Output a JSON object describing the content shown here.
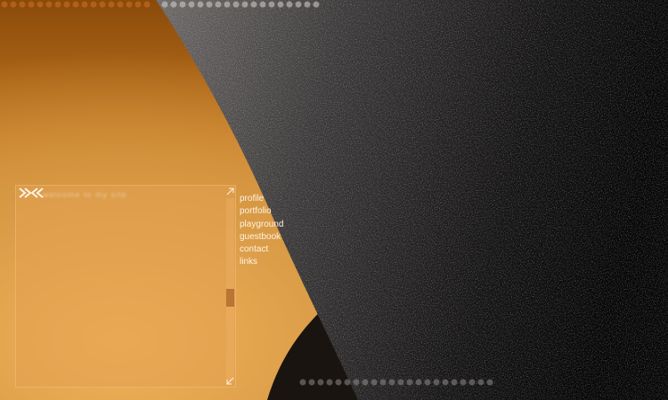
{
  "panel": {
    "title": "welcome to my site",
    "scroll_position": 0.55
  },
  "nav": {
    "items": [
      {
        "label": "profile"
      },
      {
        "label": "portfolio"
      },
      {
        "label": "playground"
      },
      {
        "label": "guestbook"
      },
      {
        "label": "contact"
      },
      {
        "label": "links"
      }
    ]
  },
  "icons": {
    "logo": "xk-logo-icon",
    "expand": "arrow-up-right-icon",
    "collapse": "arrow-down-left-icon"
  },
  "colors": {
    "accent_orange": "#e3a34e",
    "dark": "#000000",
    "nav_text": "#fff2e2"
  }
}
